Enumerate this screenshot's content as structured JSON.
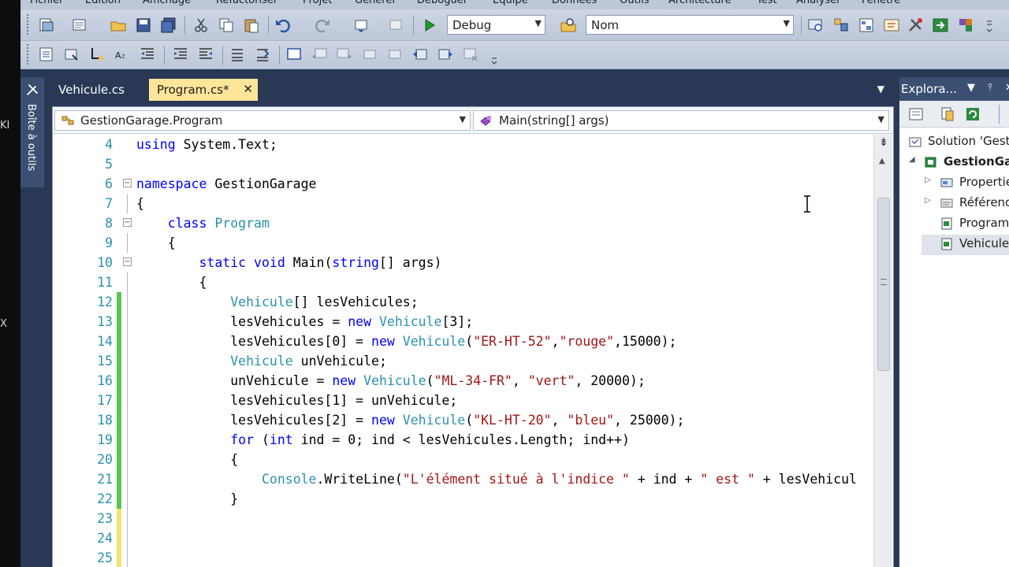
{
  "menu": {
    "items": [
      "Fichier",
      "Edition",
      "Affichage",
      "Refactoriser",
      "Projet",
      "Générer",
      "Déboguer",
      "Equipe",
      "Données",
      "Outils",
      "Architecture",
      "Test",
      "Analyser",
      "Fenêtre"
    ]
  },
  "left_edge": {
    "top_text": "KI",
    "bottom_text": "X"
  },
  "toolbar": {
    "config_select": "Debug",
    "find_select": "Nom"
  },
  "toolbox": {
    "label": "Boîte à outils"
  },
  "tabs": [
    {
      "label": "Vehicule.cs",
      "active": false
    },
    {
      "label": "Program.cs*",
      "active": true
    }
  ],
  "navbar": {
    "type_select": "GestionGarage.Program",
    "member_select": "Main(string[] args)"
  },
  "code_lines": [
    {
      "n": "4",
      "change": "none",
      "fold": "none",
      "tokens": [
        [
          "kw",
          "using"
        ],
        [
          "p",
          " System.Text;"
        ]
      ]
    },
    {
      "n": "5",
      "change": "none",
      "fold": "none",
      "tokens": []
    },
    {
      "n": "6",
      "change": "none",
      "fold": "minus",
      "tokens": [
        [
          "kw",
          "namespace"
        ],
        [
          "p",
          " GestionGarage"
        ]
      ]
    },
    {
      "n": "7",
      "change": "none",
      "fold": "line",
      "tokens": [
        [
          "p",
          "{"
        ]
      ]
    },
    {
      "n": "8",
      "change": "none",
      "fold": "minus",
      "tokens": [
        [
          "p",
          "    "
        ],
        [
          "kw",
          "class"
        ],
        [
          "p",
          " "
        ],
        [
          "ty",
          "Program"
        ]
      ]
    },
    {
      "n": "9",
      "change": "none",
      "fold": "line",
      "tokens": [
        [
          "p",
          "    {"
        ]
      ]
    },
    {
      "n": "10",
      "change": "none",
      "fold": "minus",
      "tokens": [
        [
          "p",
          "        "
        ],
        [
          "kw",
          "static"
        ],
        [
          "p",
          " "
        ],
        [
          "kw",
          "void"
        ],
        [
          "p",
          " Main("
        ],
        [
          "kw",
          "string"
        ],
        [
          "p",
          "[] args)"
        ]
      ]
    },
    {
      "n": "11",
      "change": "none",
      "fold": "line",
      "tokens": [
        [
          "p",
          "        {"
        ]
      ]
    },
    {
      "n": "12",
      "change": "saved",
      "fold": "line",
      "tokens": [
        [
          "p",
          "            "
        ],
        [
          "ty",
          "Vehicule"
        ],
        [
          "p",
          "[] lesVehicules;"
        ]
      ]
    },
    {
      "n": "13",
      "change": "saved",
      "fold": "line",
      "tokens": [
        [
          "p",
          "            lesVehicules = "
        ],
        [
          "kw",
          "new"
        ],
        [
          "p",
          " "
        ],
        [
          "ty",
          "Vehicule"
        ],
        [
          "p",
          "[3];"
        ]
      ]
    },
    {
      "n": "14",
      "change": "saved",
      "fold": "line",
      "tokens": [
        [
          "p",
          "            lesVehicules[0] = "
        ],
        [
          "kw",
          "new"
        ],
        [
          "p",
          " "
        ],
        [
          "ty",
          "Vehicule"
        ],
        [
          "p",
          "("
        ],
        [
          "st",
          "\"ER-HT-52\""
        ],
        [
          "p",
          ","
        ],
        [
          "st",
          "\"rouge\""
        ],
        [
          "p",
          ",15000);"
        ]
      ]
    },
    {
      "n": "15",
      "change": "saved",
      "fold": "line",
      "tokens": [
        [
          "p",
          "            "
        ],
        [
          "ty",
          "Vehicule"
        ],
        [
          "p",
          " unVehicule;"
        ]
      ]
    },
    {
      "n": "16",
      "change": "saved",
      "fold": "line",
      "tokens": [
        [
          "p",
          "            unVehicule = "
        ],
        [
          "kw",
          "new"
        ],
        [
          "p",
          " "
        ],
        [
          "ty",
          "Vehicule"
        ],
        [
          "p",
          "("
        ],
        [
          "st",
          "\"ML-34-FR\""
        ],
        [
          "p",
          ", "
        ],
        [
          "st",
          "\"vert\""
        ],
        [
          "p",
          ", 20000);"
        ]
      ]
    },
    {
      "n": "17",
      "change": "saved",
      "fold": "line",
      "tokens": [
        [
          "p",
          "            lesVehicules[1] = unVehicule;"
        ]
      ]
    },
    {
      "n": "18",
      "change": "saved",
      "fold": "line",
      "tokens": [
        [
          "p",
          "            lesVehicules[2] = "
        ],
        [
          "kw",
          "new"
        ],
        [
          "p",
          " "
        ],
        [
          "ty",
          "Vehicule"
        ],
        [
          "p",
          "("
        ],
        [
          "st",
          "\"KL-HT-20\""
        ],
        [
          "p",
          ", "
        ],
        [
          "st",
          "\"bleu\""
        ],
        [
          "p",
          ", 25000);"
        ]
      ]
    },
    {
      "n": "19",
      "change": "saved",
      "fold": "line",
      "tokens": [
        [
          "p",
          "            "
        ],
        [
          "kw",
          "for"
        ],
        [
          "p",
          " ("
        ],
        [
          "kw",
          "int"
        ],
        [
          "p",
          " ind = 0; ind < lesVehicules.Length; ind++)"
        ]
      ]
    },
    {
      "n": "20",
      "change": "saved",
      "fold": "line",
      "tokens": [
        [
          "p",
          "            {"
        ]
      ]
    },
    {
      "n": "21",
      "change": "saved",
      "fold": "line",
      "tokens": [
        [
          "p",
          "                "
        ],
        [
          "ty",
          "Console"
        ],
        [
          "p",
          ".WriteLine("
        ],
        [
          "st",
          "\"L'élément situé à l'indice \""
        ],
        [
          "p",
          " + ind + "
        ],
        [
          "st",
          "\" est \""
        ],
        [
          "p",
          " + lesVehicul"
        ]
      ]
    },
    {
      "n": "22",
      "change": "saved",
      "fold": "line",
      "tokens": [
        [
          "p",
          "            }"
        ]
      ]
    },
    {
      "n": "23",
      "change": "unsaved",
      "fold": "line",
      "tokens": []
    },
    {
      "n": "24",
      "change": "unsaved",
      "fold": "line",
      "tokens": []
    },
    {
      "n": "25",
      "change": "unsaved",
      "fold": "line",
      "tokens": []
    }
  ],
  "explorer": {
    "title": "Explora...",
    "tree": [
      {
        "label": "Solution 'GestionGarage'",
        "indent": 0,
        "expander": "",
        "icon": "solution-icon",
        "bold": false,
        "selected": false
      },
      {
        "label": "GestionGarage",
        "indent": 1,
        "expander": "◢",
        "icon": "csharp-project-icon",
        "bold": true,
        "selected": false
      },
      {
        "label": "Properties",
        "indent": 2,
        "expander": "▷",
        "icon": "properties-icon",
        "bold": false,
        "selected": false
      },
      {
        "label": "Références",
        "indent": 2,
        "expander": "▷",
        "icon": "references-icon",
        "bold": false,
        "selected": false
      },
      {
        "label": "Program.cs",
        "indent": 2,
        "expander": "",
        "icon": "csharp-file-icon",
        "bold": false,
        "selected": false
      },
      {
        "label": "Vehicule.cs",
        "indent": 2,
        "expander": "",
        "icon": "csharp-file-icon",
        "bold": false,
        "selected": true
      }
    ]
  },
  "colors": {
    "keyword": "#0000ff",
    "type": "#2b91af",
    "string": "#a31515",
    "line_number": "#2b91af",
    "change_saved": "#57c457",
    "change_unsaved": "#f2e56b",
    "active_tab": "#fde599",
    "chrome_dark": "#293955"
  }
}
